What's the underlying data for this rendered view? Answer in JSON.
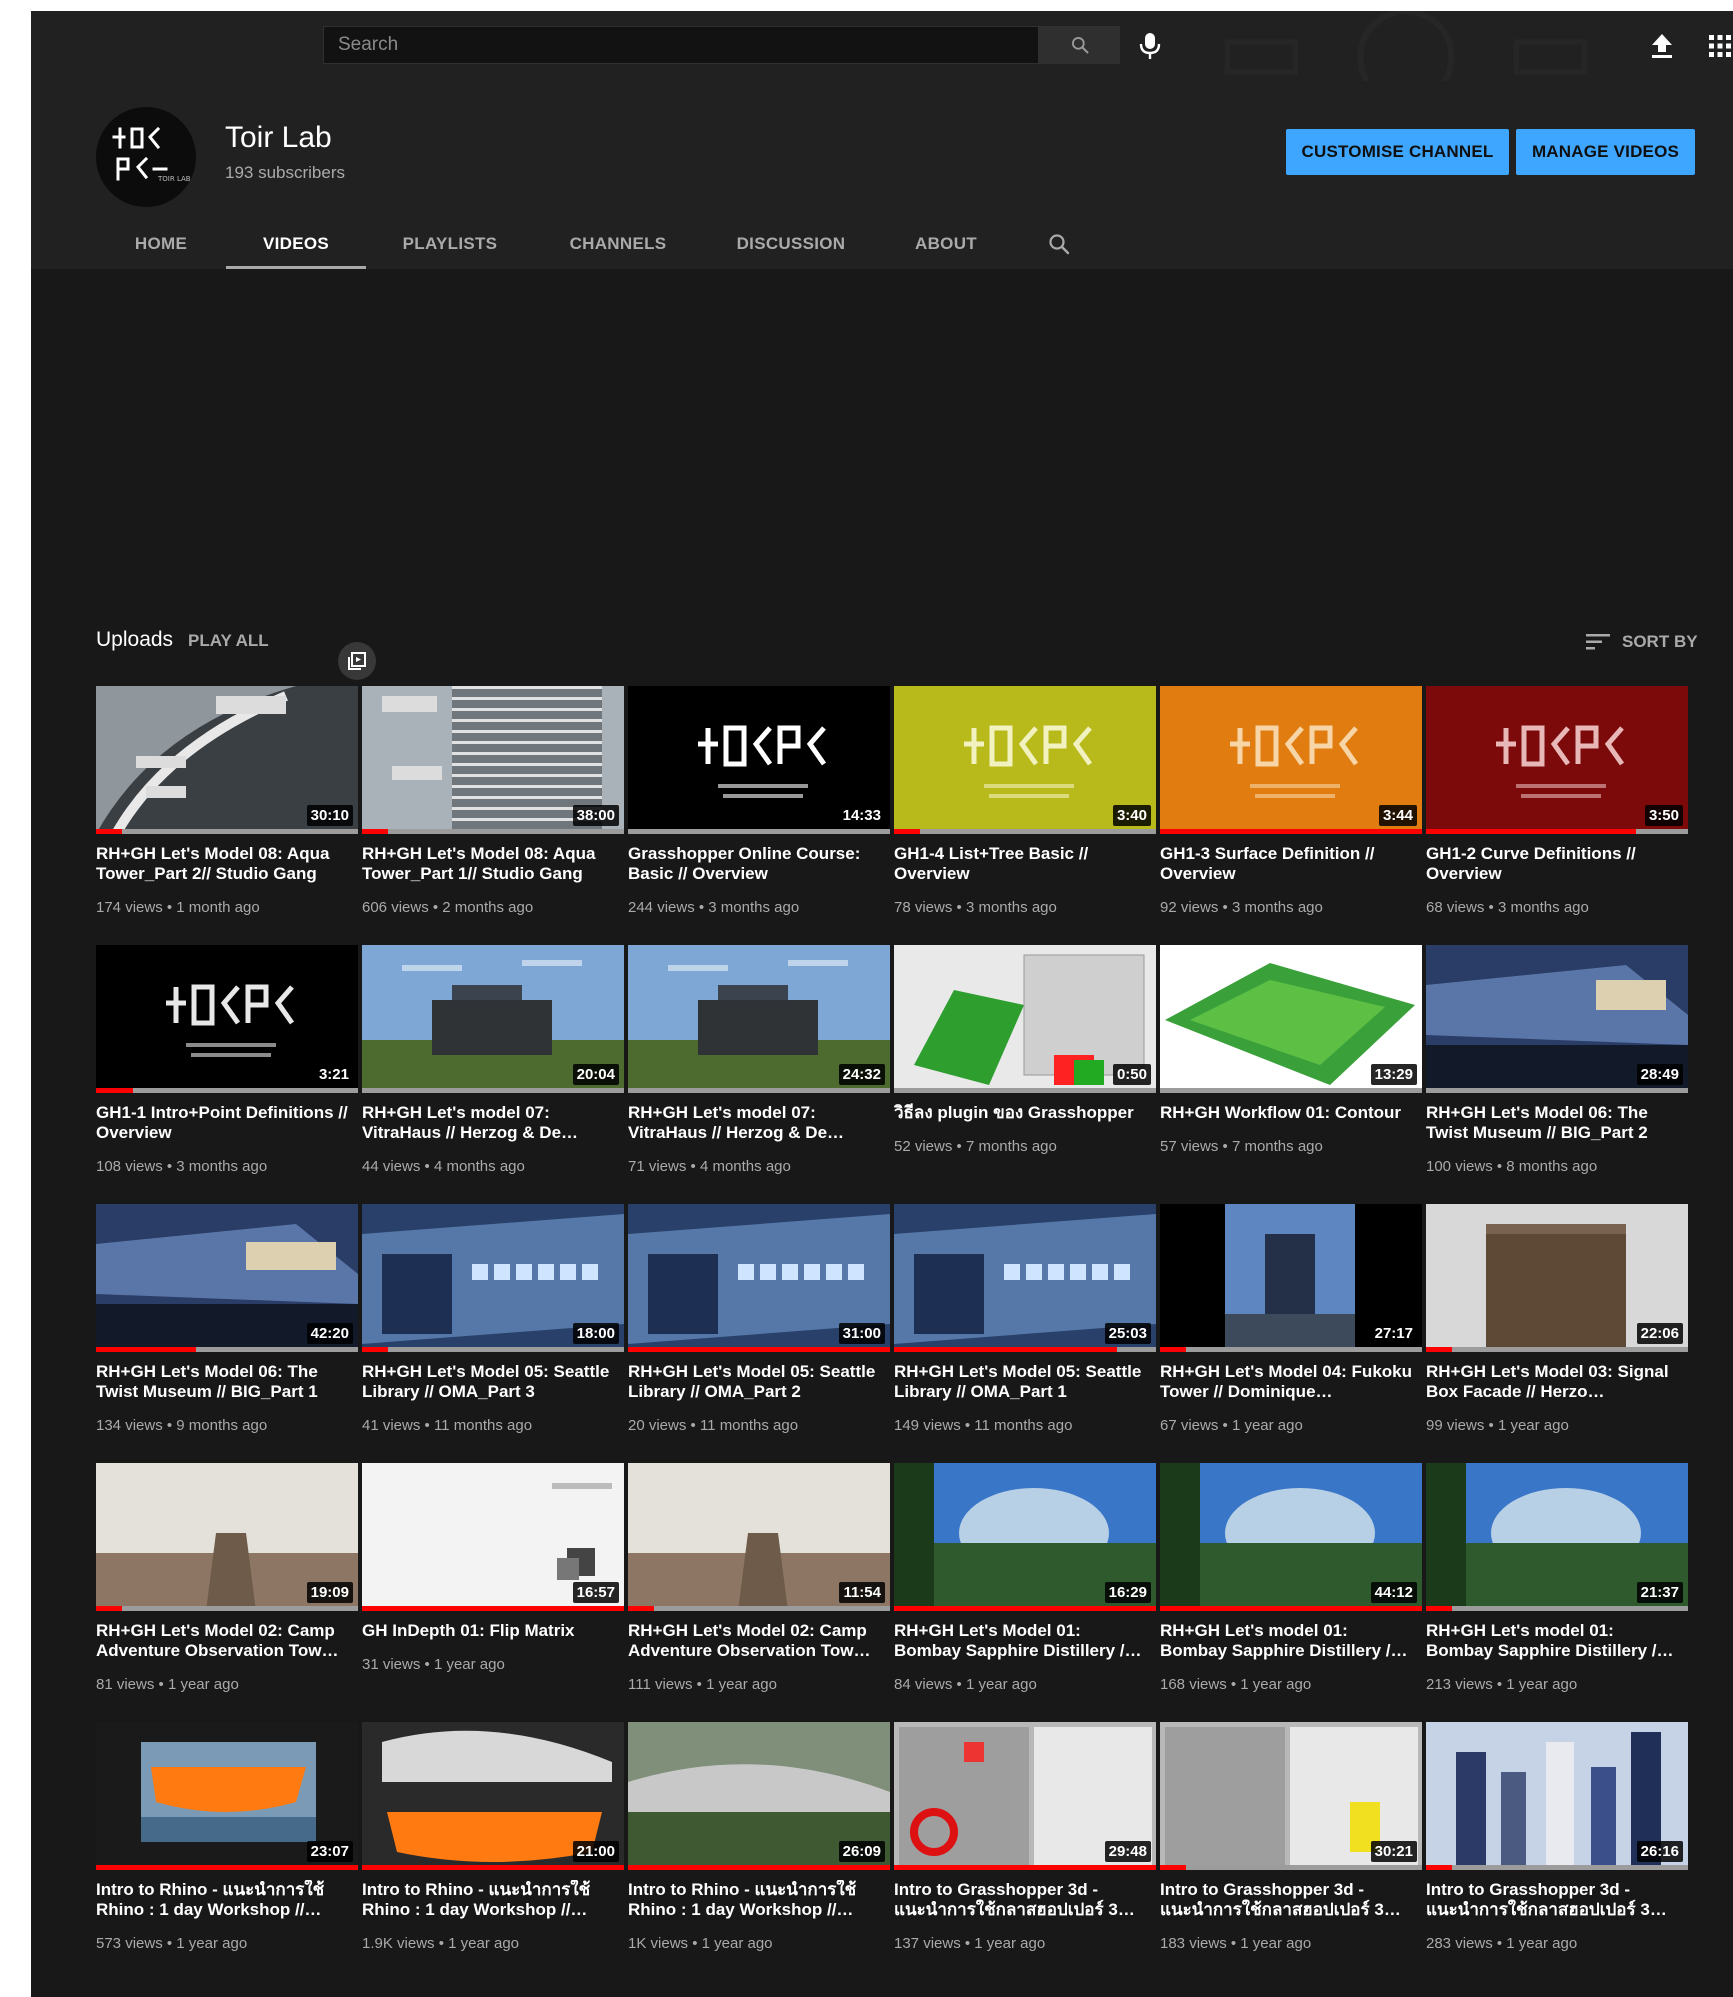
{
  "masthead": {
    "search_placeholder": "Search"
  },
  "channel": {
    "name": "Toir Lab",
    "subscribers": "193 subscribers",
    "customise_label": "CUSTOMISE CHANNEL",
    "manage_label": "MANAGE VIDEOS",
    "avatar_glyphs": "ᚁᛞᛈ"
  },
  "tabs": [
    {
      "label": "HOME",
      "active": false
    },
    {
      "label": "VIDEOS",
      "active": true
    },
    {
      "label": "PLAYLISTS",
      "active": false
    },
    {
      "label": "CHANNELS",
      "active": false
    },
    {
      "label": "DISCUSSION",
      "active": false
    },
    {
      "label": "ABOUT",
      "active": false
    }
  ],
  "uploads": {
    "title": "Uploads",
    "play_all": "PLAY ALL",
    "sort_by": "SORT BY"
  },
  "colors": {
    "accent_blue": "#3ea6ff",
    "progress_red": "#ff0000",
    "background": "#181818",
    "header": "#212121"
  },
  "videos": [
    {
      "title": "RH+GH Let's Model 08: Aqua Tower_Part 2// Studio Gang",
      "views": "174 views",
      "age": "1 month ago",
      "duration": "30:10",
      "progress": 0.1,
      "thumb": "aqua-tower"
    },
    {
      "title": "RH+GH Let's Model 08: Aqua Tower_Part 1// Studio Gang",
      "views": "606 views",
      "age": "2 months ago",
      "duration": "38:00",
      "progress": 0.1,
      "thumb": "aqua-tower-2"
    },
    {
      "title": "Grasshopper Online Course: Basic // Overview",
      "views": "244 views",
      "age": "3 months ago",
      "duration": "14:33",
      "progress": 0,
      "thumb": "logo-black"
    },
    {
      "title": "GH1-4 List+Tree Basic // Overview",
      "views": "78 views",
      "age": "3 months ago",
      "duration": "3:40",
      "progress": 0.1,
      "thumb": "logo-olive"
    },
    {
      "title": "GH1-3 Surface Definition // Overview",
      "views": "92 views",
      "age": "3 months ago",
      "duration": "3:44",
      "progress": 1,
      "thumb": "logo-orange"
    },
    {
      "title": "GH1-2 Curve Definitions // Overview",
      "views": "68 views",
      "age": "3 months ago",
      "duration": "3:50",
      "progress": 0.8,
      "thumb": "logo-red"
    },
    {
      "title": "GH1-1 Intro+Point Definitions // Overview",
      "views": "108 views",
      "age": "3 months ago",
      "duration": "3:21",
      "progress": 0.14,
      "thumb": "logo-black-2"
    },
    {
      "title": "RH+GH Let's model 07: VitraHaus // Herzog & De…",
      "views": "44 views",
      "age": "4 months ago",
      "duration": "20:04",
      "progress": 0,
      "thumb": "vitrahaus"
    },
    {
      "title": "RH+GH Let's model 07: VitraHaus // Herzog & De…",
      "views": "71 views",
      "age": "4 months ago",
      "duration": "24:32",
      "progress": 0,
      "thumb": "vitrahaus-2"
    },
    {
      "title": "วิธีลง plugin ของ Grasshopper",
      "views": "52 views",
      "age": "7 months ago",
      "duration": "0:50",
      "progress": 0,
      "thumb": "plugin"
    },
    {
      "title": "RH+GH Workflow 01: Contour",
      "views": "57 views",
      "age": "7 months ago",
      "duration": "13:29",
      "progress": 0,
      "thumb": "contour"
    },
    {
      "title": "RH+GH Let's Model 06: The Twist Museum // BIG_Part 2",
      "views": "100 views",
      "age": "8 months ago",
      "duration": "28:49",
      "progress": 0,
      "thumb": "twist"
    },
    {
      "title": "RH+GH Let's Model 06: The Twist Museum // BIG_Part 1",
      "views": "134 views",
      "age": "9 months ago",
      "duration": "42:20",
      "progress": 0.38,
      "thumb": "twist-2"
    },
    {
      "title": "RH+GH Let's Model 05: Seattle Library // OMA_Part 3",
      "views": "41 views",
      "age": "11 months ago",
      "duration": "18:00",
      "progress": 0.1,
      "thumb": "seattle"
    },
    {
      "title": "RH+GH Let's Model 05: Seattle Library // OMA_Part 2",
      "views": "20 views",
      "age": "11 months ago",
      "duration": "31:00",
      "progress": 1,
      "thumb": "seattle-2"
    },
    {
      "title": "RH+GH Let's Model 05: Seattle Library // OMA_Part 1",
      "views": "149 views",
      "age": "11 months ago",
      "duration": "25:03",
      "progress": 0.85,
      "thumb": "seattle-3"
    },
    {
      "title": "RH+GH Let's Model 04: Fukoku Tower // Dominique…",
      "views": "67 views",
      "age": "1 year ago",
      "duration": "27:17",
      "progress": 0.1,
      "thumb": "fukoku"
    },
    {
      "title": "RH+GH Let's Model 03: Signal Box Facade // Herzo…",
      "views": "99 views",
      "age": "1 year ago",
      "duration": "22:06",
      "progress": 0.1,
      "thumb": "signal-box"
    },
    {
      "title": "RH+GH Let's Model 02: Camp Adventure Observation Tow…",
      "views": "81 views",
      "age": "1 year ago",
      "duration": "19:09",
      "progress": 0.1,
      "thumb": "camp"
    },
    {
      "title": "GH InDepth 01: Flip Matrix",
      "views": "31 views",
      "age": "1 year ago",
      "duration": "16:57",
      "progress": 1,
      "thumb": "flip"
    },
    {
      "title": "RH+GH Let's Model 02: Camp Adventure Observation Tow…",
      "views": "111 views",
      "age": "1 year ago",
      "duration": "11:54",
      "progress": 0.1,
      "thumb": "camp-2"
    },
    {
      "title": "RH+GH Let's Model 01: Bombay Sapphire Distillery /…",
      "views": "84 views",
      "age": "1 year ago",
      "duration": "16:29",
      "progress": 1,
      "thumb": "bombay"
    },
    {
      "title": "RH+GH Let's model 01: Bombay Sapphire Distillery /…",
      "views": "168 views",
      "age": "1 year ago",
      "duration": "44:12",
      "progress": 1,
      "thumb": "bombay-2"
    },
    {
      "title": "RH+GH Let's model 01: Bombay Sapphire Distillery /…",
      "views": "213 views",
      "age": "1 year ago",
      "duration": "21:37",
      "progress": 0.1,
      "thumb": "bombay-3"
    },
    {
      "title": "Intro to Rhino - แนะนำการใช้ Rhino : 1 day Workshop //…",
      "views": "573 views",
      "age": "1 year ago",
      "duration": "23:07",
      "progress": 1,
      "thumb": "rhino"
    },
    {
      "title": "Intro to Rhino - แนะนำการใช้ Rhino : 1 day Workshop //…",
      "views": "1.9K views",
      "age": "1 year ago",
      "duration": "21:00",
      "progress": 1,
      "thumb": "rhino-2"
    },
    {
      "title": "Intro to Rhino - แนะนำการใช้ Rhino : 1 day Workshop //…",
      "views": "1K views",
      "age": "1 year ago",
      "duration": "26:09",
      "progress": 1,
      "thumb": "rhino-3"
    },
    {
      "title": "Intro to Grasshopper 3d - แนะนำการใช้กลาสฮอปเปอร์ 3…",
      "views": "137 views",
      "age": "1 year ago",
      "duration": "29:48",
      "progress": 1,
      "thumb": "gh3d"
    },
    {
      "title": "Intro to Grasshopper 3d - แนะนำการใช้กลาสฮอปเปอร์ 3…",
      "views": "183 views",
      "age": "1 year ago",
      "duration": "30:21",
      "progress": 0.1,
      "thumb": "gh3d-2"
    },
    {
      "title": "Intro to Grasshopper 3d - แนะนำการใช้กลาสฮอปเปอร์ 3…",
      "views": "283 views",
      "age": "1 year ago",
      "duration": "26:16",
      "progress": 0.1,
      "thumb": "gh3d-3"
    }
  ]
}
